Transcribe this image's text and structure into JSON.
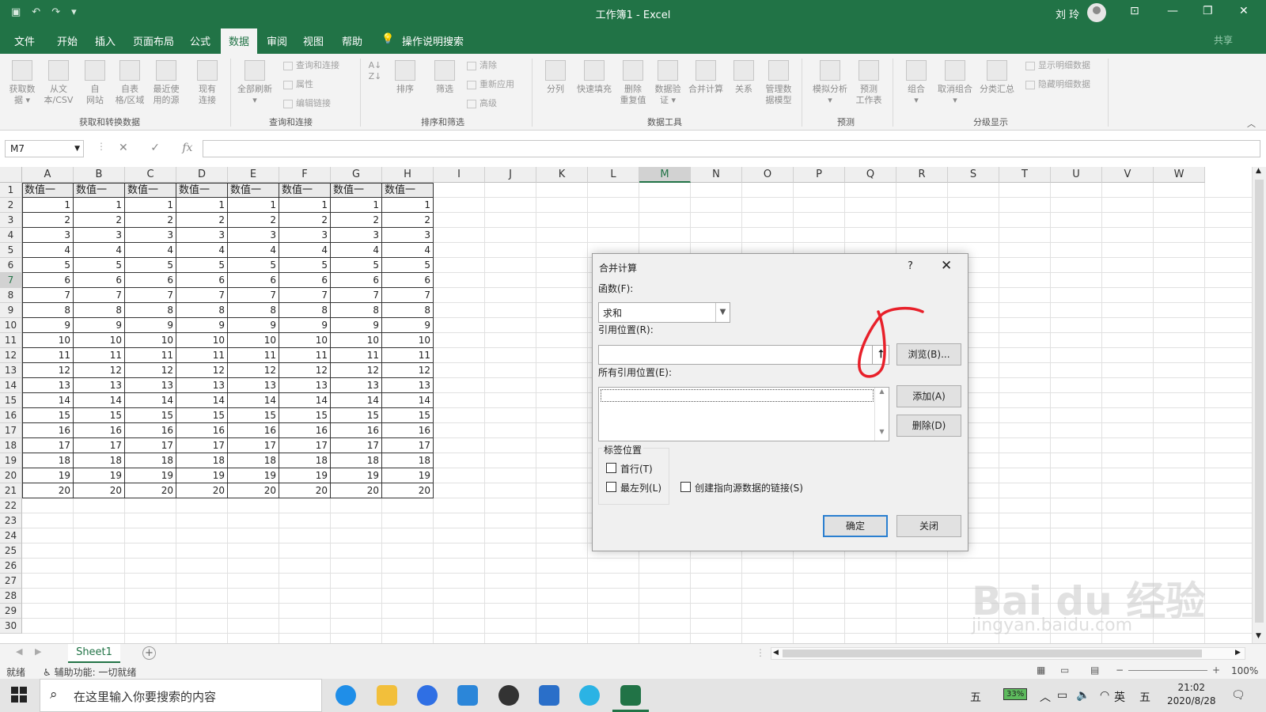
{
  "window": {
    "title": "工作簿1 - Excel",
    "user": "刘 玲"
  },
  "menu": {
    "tabs": [
      "文件",
      "开始",
      "插入",
      "页面布局",
      "公式",
      "数据",
      "审阅",
      "视图",
      "帮助"
    ],
    "active": "数据",
    "search": "操作说明搜索",
    "share": "共享"
  },
  "ribbon": {
    "get_transform": {
      "label": "获取和转换数据",
      "buttons": [
        "获取数\n据 ▾",
        "从文\n本/CSV",
        "自\n网站",
        "自表\n格/区域",
        "最近使\n用的源",
        "现有\n连接"
      ]
    },
    "queries": {
      "label": "查询和连接",
      "refresh": "全部刷新\n▾",
      "items": [
        "查询和连接",
        "属性",
        "编辑链接"
      ]
    },
    "sort_filter": {
      "label": "排序和筛选",
      "sort": "排序",
      "filter": "筛选",
      "items": [
        "清除",
        "重新应用",
        "高级"
      ]
    },
    "data_tools": {
      "label": "数据工具",
      "buttons": [
        "分列",
        "快速填充",
        "删除\n重复值",
        "数据验\n证 ▾",
        "合并计算",
        "关系",
        "管理数\n据模型"
      ]
    },
    "forecast": {
      "label": "预测",
      "buttons": [
        "模拟分析\n▾",
        "预测\n工作表"
      ]
    },
    "outline": {
      "label": "分级显示",
      "buttons": [
        "组合\n▾",
        "取消组合\n▾",
        "分类汇总"
      ],
      "items": [
        "显示明细数据",
        "隐藏明细数据"
      ]
    }
  },
  "formula_bar": {
    "name_box": "M7",
    "fx": "fx",
    "formula": ""
  },
  "sheet": {
    "columns": [
      "A",
      "B",
      "C",
      "D",
      "E",
      "F",
      "G",
      "H",
      "I",
      "J",
      "K",
      "L",
      "M",
      "N",
      "O",
      "P",
      "Q",
      "R",
      "S",
      "T",
      "U",
      "V",
      "W"
    ],
    "selected_column": "M",
    "selected_row": 7,
    "row_numbers": [
      "1",
      "2",
      "3",
      "4",
      "5",
      "6",
      "7",
      "8",
      "9",
      "10",
      "11",
      "12",
      "13",
      "14",
      "15",
      "16",
      "17",
      "18",
      "19",
      "20",
      "21",
      "22",
      "23",
      "24",
      "25",
      "26",
      "27",
      "28",
      "29",
      "30"
    ],
    "header_row": [
      "数值一",
      "数值一",
      "数值一",
      "数值一",
      "数值一",
      "数值一",
      "数值一",
      "数值一"
    ],
    "rows": [
      [
        "1",
        "1",
        "1",
        "1",
        "1",
        "1",
        "1",
        "1"
      ],
      [
        "2",
        "2",
        "2",
        "2",
        "2",
        "2",
        "2",
        "2"
      ],
      [
        "3",
        "3",
        "3",
        "3",
        "3",
        "3",
        "3",
        "3"
      ],
      [
        "4",
        "4",
        "4",
        "4",
        "4",
        "4",
        "4",
        "4"
      ],
      [
        "5",
        "5",
        "5",
        "5",
        "5",
        "5",
        "5",
        "5"
      ],
      [
        "6",
        "6",
        "6",
        "6",
        "6",
        "6",
        "6",
        "6"
      ],
      [
        "7",
        "7",
        "7",
        "7",
        "7",
        "7",
        "7",
        "7"
      ],
      [
        "8",
        "8",
        "8",
        "8",
        "8",
        "8",
        "8",
        "8"
      ],
      [
        "9",
        "9",
        "9",
        "9",
        "9",
        "9",
        "9",
        "9"
      ],
      [
        "10",
        "10",
        "10",
        "10",
        "10",
        "10",
        "10",
        "10"
      ],
      [
        "11",
        "11",
        "11",
        "11",
        "11",
        "11",
        "11",
        "11"
      ],
      [
        "12",
        "12",
        "12",
        "12",
        "12",
        "12",
        "12",
        "12"
      ],
      [
        "13",
        "13",
        "13",
        "13",
        "13",
        "13",
        "13",
        "13"
      ],
      [
        "14",
        "14",
        "14",
        "14",
        "14",
        "14",
        "14",
        "14"
      ],
      [
        "15",
        "15",
        "15",
        "15",
        "15",
        "15",
        "15",
        "15"
      ],
      [
        "16",
        "16",
        "16",
        "16",
        "16",
        "16",
        "16",
        "16"
      ],
      [
        "17",
        "17",
        "17",
        "17",
        "17",
        "17",
        "17",
        "17"
      ],
      [
        "18",
        "18",
        "18",
        "18",
        "18",
        "18",
        "18",
        "18"
      ],
      [
        "19",
        "19",
        "19",
        "19",
        "19",
        "19",
        "19",
        "19"
      ],
      [
        "20",
        "20",
        "20",
        "20",
        "20",
        "20",
        "20",
        "20"
      ]
    ],
    "tab": "Sheet1"
  },
  "dialog": {
    "title": "合并计算",
    "help": "?",
    "function_label": "函数(F):",
    "function_value": "求和",
    "reference_label": "引用位置(R):",
    "reference_value": "",
    "browse": "浏览(B)...",
    "all_refs_label": "所有引用位置(E):",
    "add": "添加(A)",
    "delete": "删除(D)",
    "label_group": "标签位置",
    "top_row": "首行(T)",
    "left_column": "最左列(L)",
    "create_links": "创建指向源数据的链接(S)",
    "ok": "确定",
    "close": "关闭"
  },
  "status": {
    "ready": "就绪",
    "accessibility": "辅助功能: 一切就绪",
    "zoom": "100%"
  },
  "taskbar": {
    "search_placeholder": "在这里输入你要搜索的内容",
    "battery": "33%",
    "ime_lang": "英",
    "ime_mode": "五",
    "time": "21:02",
    "date": "2020/8/28"
  },
  "watermark": {
    "text": "Bai du 经验",
    "sub": "jingyan.baidu.com"
  },
  "colors": {
    "excel_green": "#217346",
    "annotation_red": "#e8202a"
  }
}
